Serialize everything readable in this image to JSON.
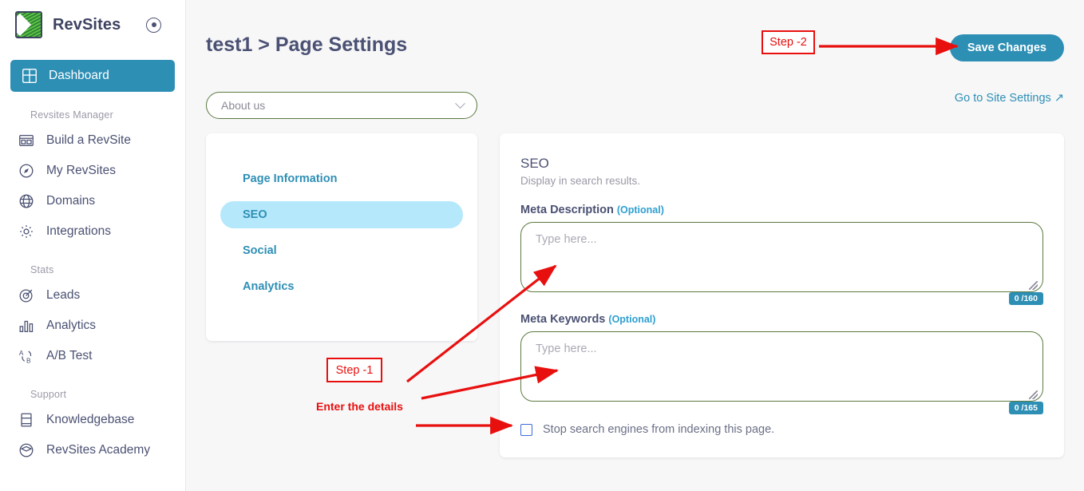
{
  "brand": {
    "name": "RevSites",
    "logo_icon": "revsites-logo-icon",
    "toggle_icon": "collapse-toggle-icon"
  },
  "sidebar": {
    "active_item": {
      "label": "Dashboard",
      "icon": "dashboard-grid-icon"
    },
    "groups": [
      {
        "title": "Revsites Manager",
        "items": [
          {
            "label": "Build a RevSite",
            "icon": "browser-layout-icon"
          },
          {
            "label": "My RevSites",
            "icon": "compass-icon"
          },
          {
            "label": "Domains",
            "icon": "globe-icon"
          },
          {
            "label": "Integrations",
            "icon": "gear-icon"
          }
        ]
      },
      {
        "title": "Stats",
        "items": [
          {
            "label": "Leads",
            "icon": "target-icon"
          },
          {
            "label": "Analytics",
            "icon": "bar-chart-icon"
          },
          {
            "label": "A/B Test",
            "icon": "ab-test-icon"
          }
        ]
      },
      {
        "title": "Support",
        "items": [
          {
            "label": "Knowledgebase",
            "icon": "book-icon"
          },
          {
            "label": "RevSites Academy",
            "icon": "graduation-icon"
          }
        ]
      }
    ]
  },
  "header": {
    "title": "test1 > Page Settings",
    "save_label": "Save Changes",
    "site_settings_label": "Go to Site Settings",
    "site_settings_icon": "external-link-arrow-icon"
  },
  "page_select": {
    "value": "About us",
    "icon": "chevron-down-icon"
  },
  "sections": [
    {
      "label": "Page Information",
      "active": false
    },
    {
      "label": "SEO",
      "active": true
    },
    {
      "label": "Social",
      "active": false
    },
    {
      "label": "Analytics",
      "active": false
    }
  ],
  "seo": {
    "heading": "SEO",
    "subheading": "Display in search results.",
    "meta_description": {
      "label": "Meta Description",
      "optional": "(Optional)",
      "value": "",
      "placeholder": "Type here...",
      "counter": "0 /160"
    },
    "meta_keywords": {
      "label": "Meta Keywords",
      "optional": "(Optional)",
      "value": "",
      "placeholder": "Type here...",
      "counter": "0 /165"
    },
    "noindex": {
      "label": "Stop search engines from indexing this page.",
      "checked": false
    }
  },
  "annotations": {
    "step1_box": "Step -1",
    "step1_note": "Enter the details",
    "step2_box": "Step -2",
    "color": "#e8100f"
  },
  "colors": {
    "accent_teal": "#2e8fb5",
    "highlight_blue": "#b5e8fb",
    "sidebar_text": "#4b5173",
    "field_border_green": "#5b7a3f",
    "optional_blue": "#2e9fd0",
    "page_bg": "#f7f7f8"
  }
}
